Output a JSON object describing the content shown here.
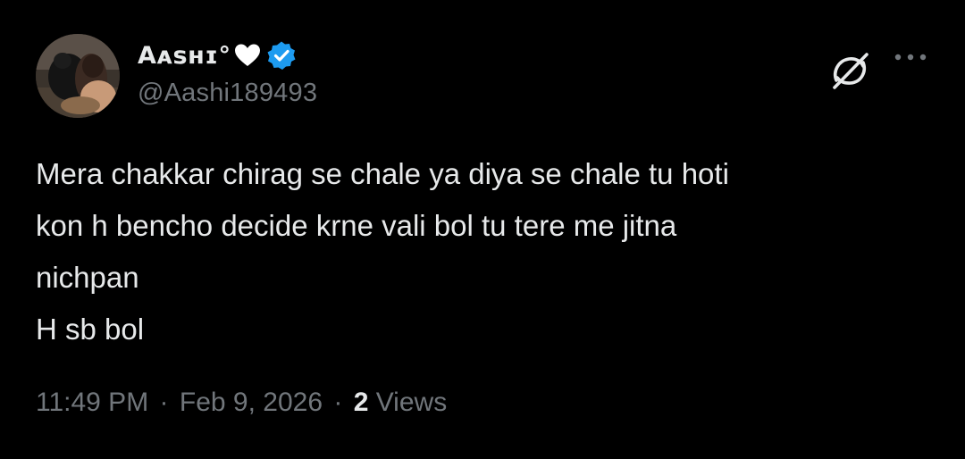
{
  "tweet": {
    "author": {
      "display_name": "Aᴀsʜɪ°",
      "handle": "@Aashi189493",
      "heart_icon": "white-heart-icon",
      "verified_icon": "verified-badge-icon",
      "verified_color": "#1d9bf0"
    },
    "text": "Mera chakkar chirag se chale ya diya se chale tu hoti\nkon h bencho decide krne vali bol tu tere me jitna\nnichpan\nH sb bol",
    "meta": {
      "time": "11:49 PM",
      "separator": "·",
      "date": "Feb 9, 2026",
      "views_count": "2",
      "views_label": "Views"
    },
    "actions": {
      "grok_icon": "grok-icon",
      "more_icon": "more-options-icon"
    }
  },
  "colors": {
    "background": "#000000",
    "primary_text": "#e7e9ea",
    "secondary_text": "#71767b",
    "accent": "#1d9bf0"
  }
}
